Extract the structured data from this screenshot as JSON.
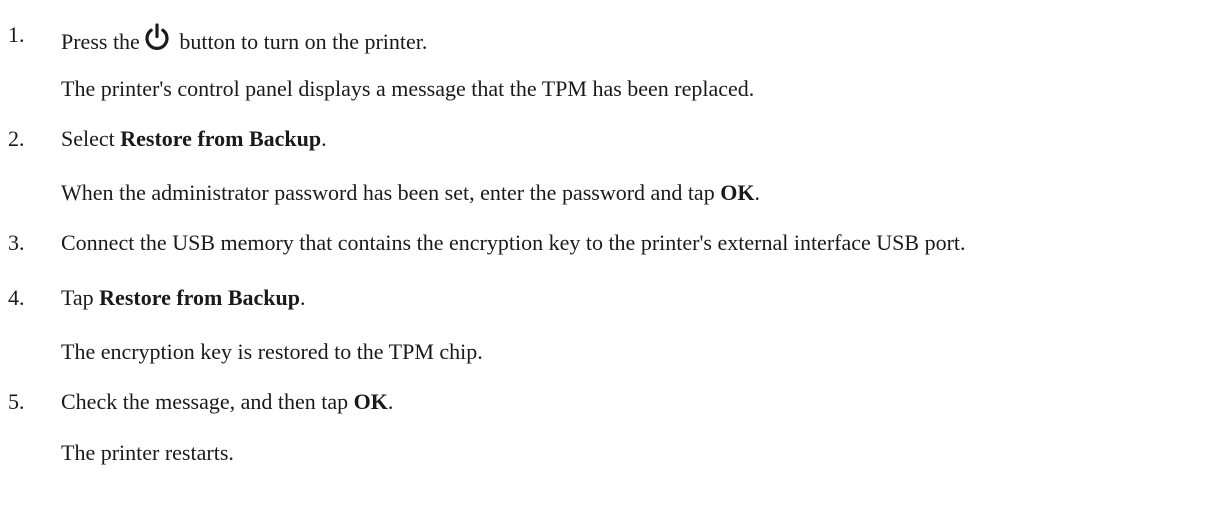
{
  "steps": [
    {
      "number": "1.",
      "pre": "Press the",
      "icon": "power-icon",
      "post": " button to turn on the printer.",
      "result": "The printer's control panel displays a message that the TPM has been replaced."
    },
    {
      "number": "2.",
      "pre": "Select ",
      "bold": "Restore from Backup",
      "post": ".",
      "result_pre": "When the administrator password has been set, enter the password and tap ",
      "result_bold": "OK",
      "result_post": "."
    },
    {
      "number": "3.",
      "text": "Connect the USB memory that contains the encryption key to the printer's external interface USB port."
    },
    {
      "number": "4.",
      "pre": "Tap ",
      "bold": "Restore from Backup",
      "post": ".",
      "result": "The encryption key is restored to the TPM chip."
    },
    {
      "number": "5.",
      "pre": "Check the message, and then tap ",
      "bold": "OK",
      "post": ".",
      "result": "The printer restarts."
    }
  ]
}
